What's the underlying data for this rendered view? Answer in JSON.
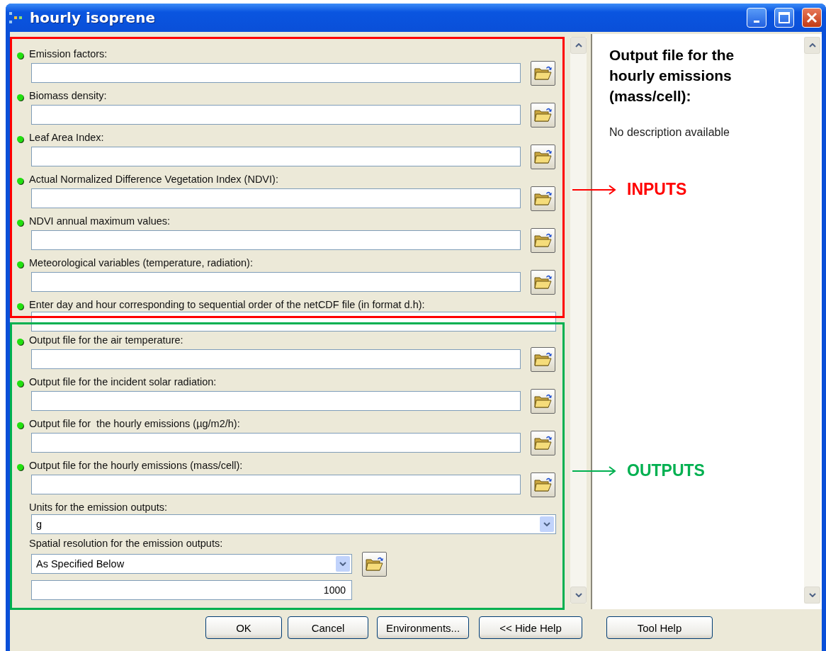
{
  "window": {
    "title": "hourly isoprene"
  },
  "parameters": [
    {
      "label": "Emission factors:",
      "required": true,
      "kind": "file"
    },
    {
      "label": "Biomass density:",
      "required": true,
      "kind": "file"
    },
    {
      "label": "Leaf Area Index:",
      "required": true,
      "kind": "file"
    },
    {
      "label": "Actual Normalized Difference Vegetation Index (NDVI):",
      "required": true,
      "kind": "file"
    },
    {
      "label": "NDVI annual maximum values:",
      "required": true,
      "kind": "file"
    },
    {
      "label": "Meteorological variables (temperature, radiation):",
      "required": true,
      "kind": "file"
    },
    {
      "label": "Enter day and hour corresponding to sequential order of the netCDF file (in format d.h):",
      "required": true,
      "kind": "text"
    },
    {
      "label": "Output file for the air temperature:",
      "required": true,
      "kind": "file"
    },
    {
      "label": "Output file for the incident solar radiation:",
      "required": true,
      "kind": "file"
    },
    {
      "label": "Output file for  the hourly emissions (µg/m2/h):",
      "required": true,
      "kind": "file"
    },
    {
      "label": "Output file for the hourly emissions (mass/cell):",
      "required": true,
      "kind": "file"
    },
    {
      "label": "Units for the emission outputs:",
      "required": false,
      "kind": "dropdown",
      "value": "g"
    },
    {
      "label": "Spatial resolution for the emission outputs:",
      "required": false,
      "kind": "dropdown_browse",
      "value": "As Specified Below",
      "extra_value": "1000"
    }
  ],
  "help": {
    "title": "Output file for the hourly emissions (mass/cell):",
    "description": "No description available"
  },
  "buttons": [
    "OK",
    "Cancel",
    "Environments...",
    "<< Hide Help",
    "Tool Help"
  ],
  "annotations": [
    {
      "label": "INPUTS",
      "color": "#ff0000"
    },
    {
      "label": "OUTPUTS",
      "color": "#00b050"
    }
  ]
}
